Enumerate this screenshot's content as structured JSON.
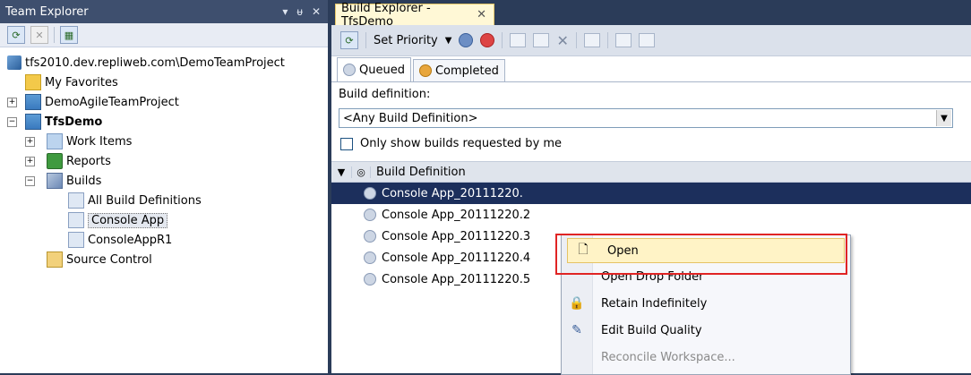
{
  "team_explorer": {
    "title": "Team Explorer",
    "title_controls": [
      "▾",
      "ᵾ",
      "✕"
    ],
    "tree": [
      {
        "label": "tfs2010.dev.repliweb.com\\DemoTeamProject",
        "icon": "server-icon"
      },
      {
        "label": "My Favorites",
        "icon": "favorites-icon"
      },
      {
        "label": "DemoAgileTeamProject",
        "icon": "team-project-icon",
        "expander": "+"
      },
      {
        "label": "TfsDemo",
        "icon": "team-project-icon",
        "expander": "−",
        "bold": true
      },
      {
        "label": "Work Items",
        "icon": "work-items-icon",
        "expander": "+"
      },
      {
        "label": "Reports",
        "icon": "reports-icon",
        "expander": "+"
      },
      {
        "label": "Builds",
        "icon": "builds-icon",
        "expander": "−"
      },
      {
        "label": "All Build Definitions",
        "icon": "build-definitions-icon"
      },
      {
        "label": "Console App",
        "icon": "build-definition-icon",
        "selected": true
      },
      {
        "label": "ConsoleAppR1",
        "icon": "build-definition-icon"
      },
      {
        "label": "Source Control",
        "icon": "source-control-icon"
      }
    ]
  },
  "build_explorer": {
    "tab_title": "Build Explorer - TfsDemo",
    "tab_close": "✕",
    "toolbar": {
      "set_priority": "Set Priority"
    },
    "subtabs": {
      "queued": "Queued",
      "completed": "Completed"
    },
    "build_definition_label": "Build definition:",
    "build_definition_value": "<Any Build Definition>",
    "only_mine_label": "Only show builds requested by me",
    "grid": {
      "header": "Build Definition",
      "rows": [
        "Console App_20111220.",
        "Console App_20111220.2",
        "Console App_20111220.3",
        "Console App_20111220.4",
        "Console App_20111220.5"
      ]
    },
    "context_menu": {
      "open": "Open",
      "open_drop_folder": "Open Drop Folder",
      "retain_indefinitely": "Retain Indefinitely",
      "edit_build_quality": "Edit Build Quality",
      "reconcile_workspace": "Reconcile Workspace..."
    }
  },
  "colors": {
    "highlight_box": "#e02424",
    "selection": "#1c2f5c",
    "menu_hover": "#fff3c6"
  }
}
